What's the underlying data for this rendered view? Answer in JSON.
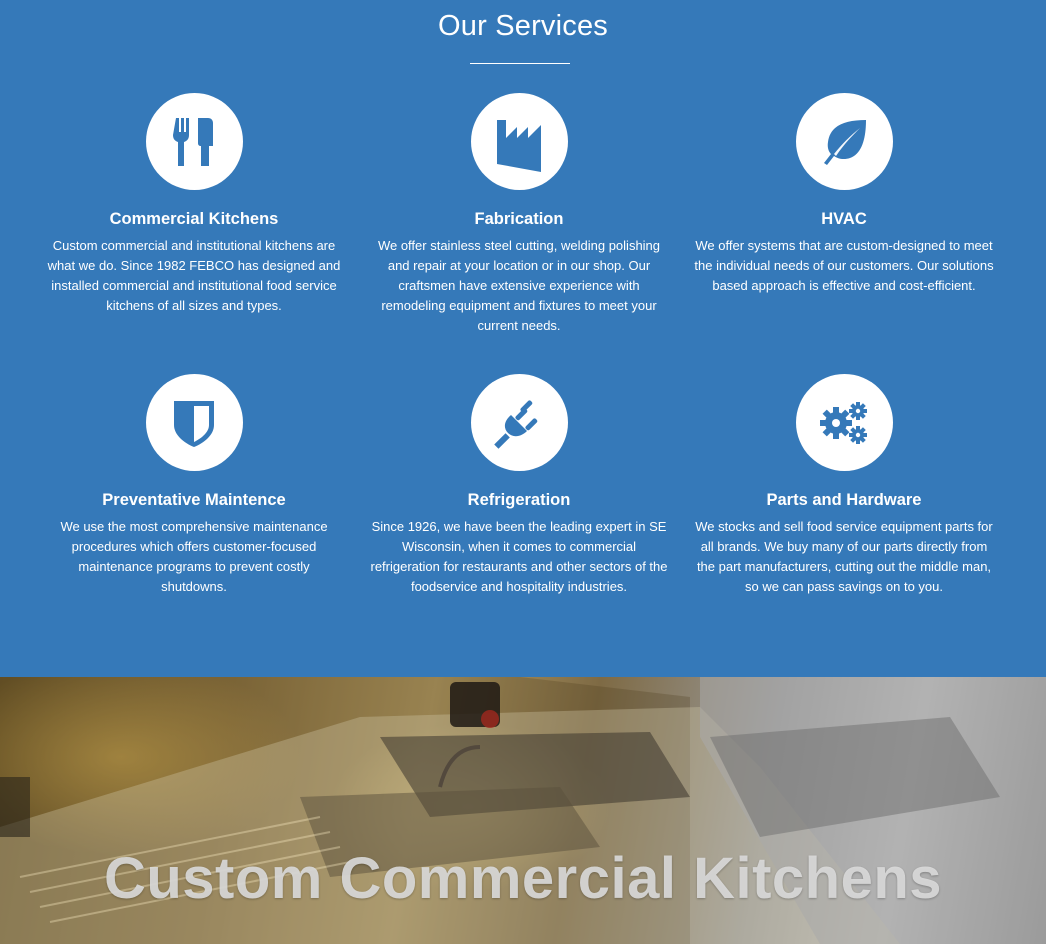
{
  "services": {
    "title": "Our Services",
    "items": [
      {
        "icon": "utensils-icon",
        "title": "Commercial Kitchens",
        "description": "Custom commercial and institutional kitchens are what we do. Since 1982 FEBCO has designed and installed commercial and institutional food service kitchens of all sizes and types."
      },
      {
        "icon": "factory-icon",
        "title": "Fabrication",
        "description": "We offer stainless steel cutting, welding polishing and repair at your location or in our shop. Our craftsmen have extensive experience with remodeling equipment and fixtures to meet your current needs."
      },
      {
        "icon": "leaf-icon",
        "title": "HVAC",
        "description": "We offer systems that are custom-designed to meet the individual needs of our customers. Our solutions based approach is effective and cost-efficient."
      },
      {
        "icon": "shield-icon",
        "title": "Preventative Maintence",
        "description": "We use the most comprehensive maintenance procedures which offers customer-focused maintenance programs to prevent costly shutdowns."
      },
      {
        "icon": "plug-icon",
        "title": "Refrigeration",
        "description": "Since 1926, we have been the leading expert in SE Wisconsin, when it comes to commercial refrigeration for restaurants and other sectors of the foodservice and hospitality industries."
      },
      {
        "icon": "gears-icon",
        "title": "Parts and Hardware",
        "description": "We stocks and sell food service equipment parts for all brands. We buy many of our parts directly from the part manufacturers, cutting out the middle man, so we can pass savings on to you."
      }
    ]
  },
  "hero": {
    "title": "Custom Commercial Kitchens"
  },
  "colors": {
    "section_background": "#3579b9",
    "icon_circle": "#ffffff",
    "icon_fill": "#3579b9"
  }
}
